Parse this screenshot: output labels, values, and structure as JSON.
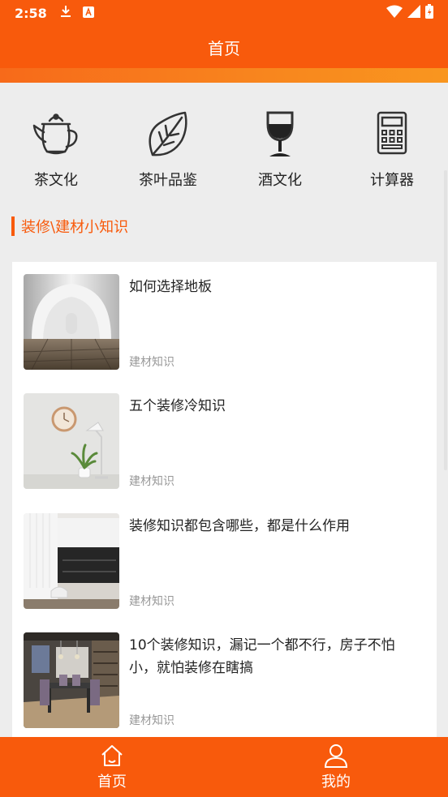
{
  "status_bar": {
    "time": "2:58",
    "icons": [
      "download-icon",
      "keyboard-a-icon",
      "wifi-icon",
      "signal-icon",
      "battery-icon"
    ]
  },
  "header": {
    "title": "首页"
  },
  "categories": [
    {
      "label": "茶文化",
      "icon": "teapot-icon"
    },
    {
      "label": "茶叶品鉴",
      "icon": "leaf-icon"
    },
    {
      "label": "酒文化",
      "icon": "wine-glass-icon"
    },
    {
      "label": "计算器",
      "icon": "calculator-icon"
    }
  ],
  "section": {
    "title": "装修\\建材小知识"
  },
  "articles": [
    {
      "title": "如何选择地板",
      "tag": "建材知识"
    },
    {
      "title": "五个装修冷知识",
      "tag": "建材知识"
    },
    {
      "title": "装修知识都包含哪些，都是什么作用",
      "tag": "建材知识"
    },
    {
      "title": "10个装修知识，漏记一个都不行，房子不怕小，就怕装修在瞎搞",
      "tag": "建材知识"
    }
  ],
  "bottom_nav": [
    {
      "label": "首页",
      "icon": "home-icon",
      "active": true
    },
    {
      "label": "我的",
      "icon": "user-icon",
      "active": false
    }
  ],
  "colors": {
    "primary": "#f85a0c",
    "gradient_end": "#f9961f",
    "background": "#ededed"
  }
}
